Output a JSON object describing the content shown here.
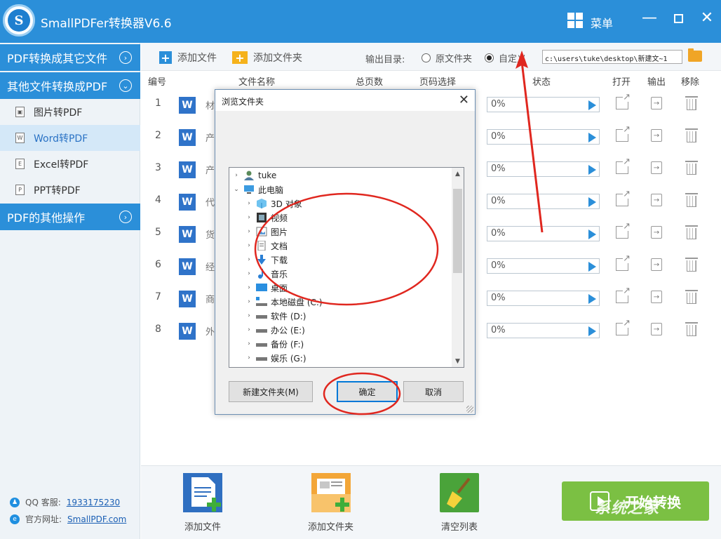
{
  "titlebar": {
    "app_title": "SmallPDFer转换器V6.6",
    "menu_label": "菜单",
    "logo_letter": "S"
  },
  "sidebar": {
    "section1": "PDF转换成其它文件",
    "section2": "其他文件转换成PDF",
    "items": [
      {
        "label": "图片转PDF",
        "icon": "image-file-icon"
      },
      {
        "label": "Word转PDF",
        "icon": "word-file-icon"
      },
      {
        "label": "Excel转PDF",
        "icon": "excel-file-icon"
      },
      {
        "label": "PPT转PDF",
        "icon": "ppt-file-icon"
      }
    ],
    "section3": "PDF的其他操作",
    "qq_label": "QQ 客服:",
    "qq_value": "1933175230",
    "site_label": "官方网址:",
    "site_value": "SmallPDF.com"
  },
  "toolbar": {
    "add_file": "添加文件",
    "add_folder": "添加文件夹",
    "output_label": "输出目录:",
    "radio_original": "原文件夹",
    "radio_custom": "自定义",
    "path_value": "c:\\users\\tuke\\desktop\\新建文~1"
  },
  "table": {
    "headers": {
      "num": "编号",
      "name": "文件名称",
      "pages": "总页数",
      "page_select": "页码选择",
      "status": "状态",
      "open": "打开",
      "output": "输出",
      "remove": "移除"
    },
    "rows": [
      {
        "num": "1",
        "name": "材",
        "progress": "0%"
      },
      {
        "num": "2",
        "name": "产",
        "progress": "0%"
      },
      {
        "num": "3",
        "name": "产",
        "progress": "0%"
      },
      {
        "num": "4",
        "name": "代",
        "progress": "0%"
      },
      {
        "num": "5",
        "name": "货",
        "progress": "0%"
      },
      {
        "num": "6",
        "name": "经",
        "progress": "0%"
      },
      {
        "num": "7",
        "name": "商",
        "progress": "0%"
      },
      {
        "num": "8",
        "name": "外",
        "progress": "0%"
      }
    ]
  },
  "dialog": {
    "title": "浏览文件夹",
    "tree": [
      {
        "label": "tuke",
        "arrow": "›",
        "icon": "user-icon",
        "level": 0
      },
      {
        "label": "此电脑",
        "arrow": "⌄",
        "icon": "computer-icon",
        "level": 0
      },
      {
        "label": "3D 对象",
        "arrow": "›",
        "icon": "cube-3d-icon",
        "level": 1
      },
      {
        "label": "视频",
        "arrow": "›",
        "icon": "video-icon",
        "level": 1
      },
      {
        "label": "图片",
        "arrow": "›",
        "icon": "picture-icon",
        "level": 1
      },
      {
        "label": "文档",
        "arrow": "›",
        "icon": "document-icon",
        "level": 1
      },
      {
        "label": "下载",
        "arrow": "›",
        "icon": "download-icon",
        "level": 1
      },
      {
        "label": "音乐",
        "arrow": "›",
        "icon": "music-icon",
        "level": 1
      },
      {
        "label": "桌面",
        "arrow": "›",
        "icon": "desktop-icon",
        "level": 1
      },
      {
        "label": "本地磁盘 (C:)",
        "arrow": "›",
        "icon": "drive-c-icon",
        "level": 1
      },
      {
        "label": "软件 (D:)",
        "arrow": "›",
        "icon": "drive-icon",
        "level": 1
      },
      {
        "label": "办公 (E:)",
        "arrow": "›",
        "icon": "drive-icon",
        "level": 1
      },
      {
        "label": "备份 (F:)",
        "arrow": "›",
        "icon": "drive-icon",
        "level": 1
      },
      {
        "label": "娱乐 (G:)",
        "arrow": "›",
        "icon": "drive-icon",
        "level": 1
      }
    ],
    "new_folder": "新建文件夹(M)",
    "ok": "确定",
    "cancel": "取消"
  },
  "bottombar": {
    "add_file": "添加文件",
    "add_folder": "添加文件夹",
    "clear_list": "清空列表",
    "start": "开始转换"
  },
  "colors": {
    "brand_blue": "#2b8fd9",
    "start_green": "#7bc043",
    "annotation_red": "#e0271f"
  }
}
